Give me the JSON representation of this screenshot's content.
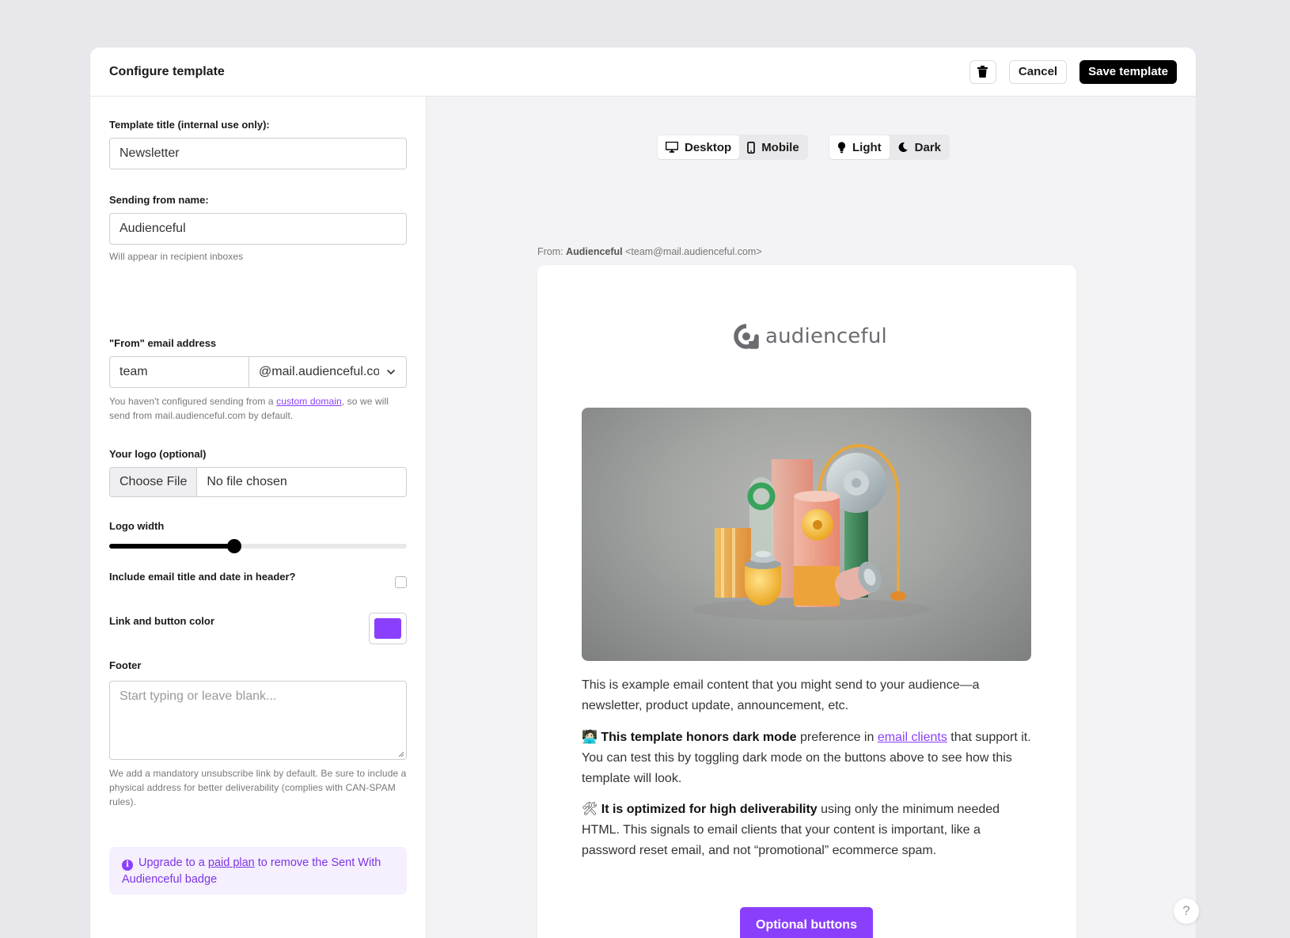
{
  "header": {
    "title": "Configure template",
    "cancel_label": "Cancel",
    "save_label": "Save template",
    "delete_icon": "trash-icon"
  },
  "form": {
    "template_title": {
      "label": "Template title (internal use only):",
      "value": "Newsletter"
    },
    "sending_name": {
      "label": "Sending from name:",
      "value": "Audienceful",
      "help": "Will appear in recipient inboxes"
    },
    "from_email": {
      "label": "\"From\" email address",
      "local_value": "team",
      "domain_value": "@mail.audienceful.com",
      "help_before": "You haven't configured sending from a ",
      "help_link": "custom domain",
      "help_after": ", so we will send from mail.audienceful.com by default."
    },
    "logo": {
      "label": "Your logo (optional)",
      "button_label": "Choose File",
      "file_status": "No file chosen"
    },
    "logo_width": {
      "label": "Logo width",
      "value_fraction": 0.42
    },
    "include_header": {
      "label": "Include email title and date in header?",
      "checked": false
    },
    "link_color": {
      "label": "Link and button color",
      "value": "#8a3ffc"
    },
    "footer": {
      "label": "Footer",
      "placeholder": "Start typing or leave blank...",
      "help": "We add a mandatory unsubscribe link by default. Be sure to include a physical address for better deliverability (complies with CAN-SPAM rules)."
    },
    "upgrade": {
      "before": "Upgrade to a ",
      "link": "paid plan",
      "after": " to remove the Sent With Audienceful badge"
    }
  },
  "preview": {
    "device_toggle": [
      {
        "label": "Desktop",
        "icon": "desktop-icon",
        "active": true
      },
      {
        "label": "Mobile",
        "icon": "mobile-icon",
        "active": false
      }
    ],
    "theme_toggle": [
      {
        "label": "Light",
        "icon": "lightbulb-icon",
        "active": true
      },
      {
        "label": "Dark",
        "icon": "moon-icon",
        "active": false
      }
    ],
    "from_prefix": "From: ",
    "from_name": "Audienceful",
    "from_address": " <team@mail.audienceful.com>",
    "email": {
      "logo_text": "audienceful",
      "para1": "This is example email content that you might send to your audience—a newsletter, product update, announcement, etc.",
      "para2_emoji": "🧑🏻‍💻",
      "para2_bold": "This template honors dark mode",
      "para2_mid": " preference in ",
      "para2_link": "email clients",
      "para2_after": " that support it. You can test this by toggling dark mode on the buttons above to see how this template will look.",
      "para3_emoji": "🛠",
      "para3_bold": "It is optimized for high deliverability",
      "para3_after": " using only the minimum needed HTML. This signals to email clients that your content is important, like a password reset email, and not “promotional” ecommerce spam.",
      "cta_label": "Optional buttons"
    }
  },
  "help_bubble": "?"
}
